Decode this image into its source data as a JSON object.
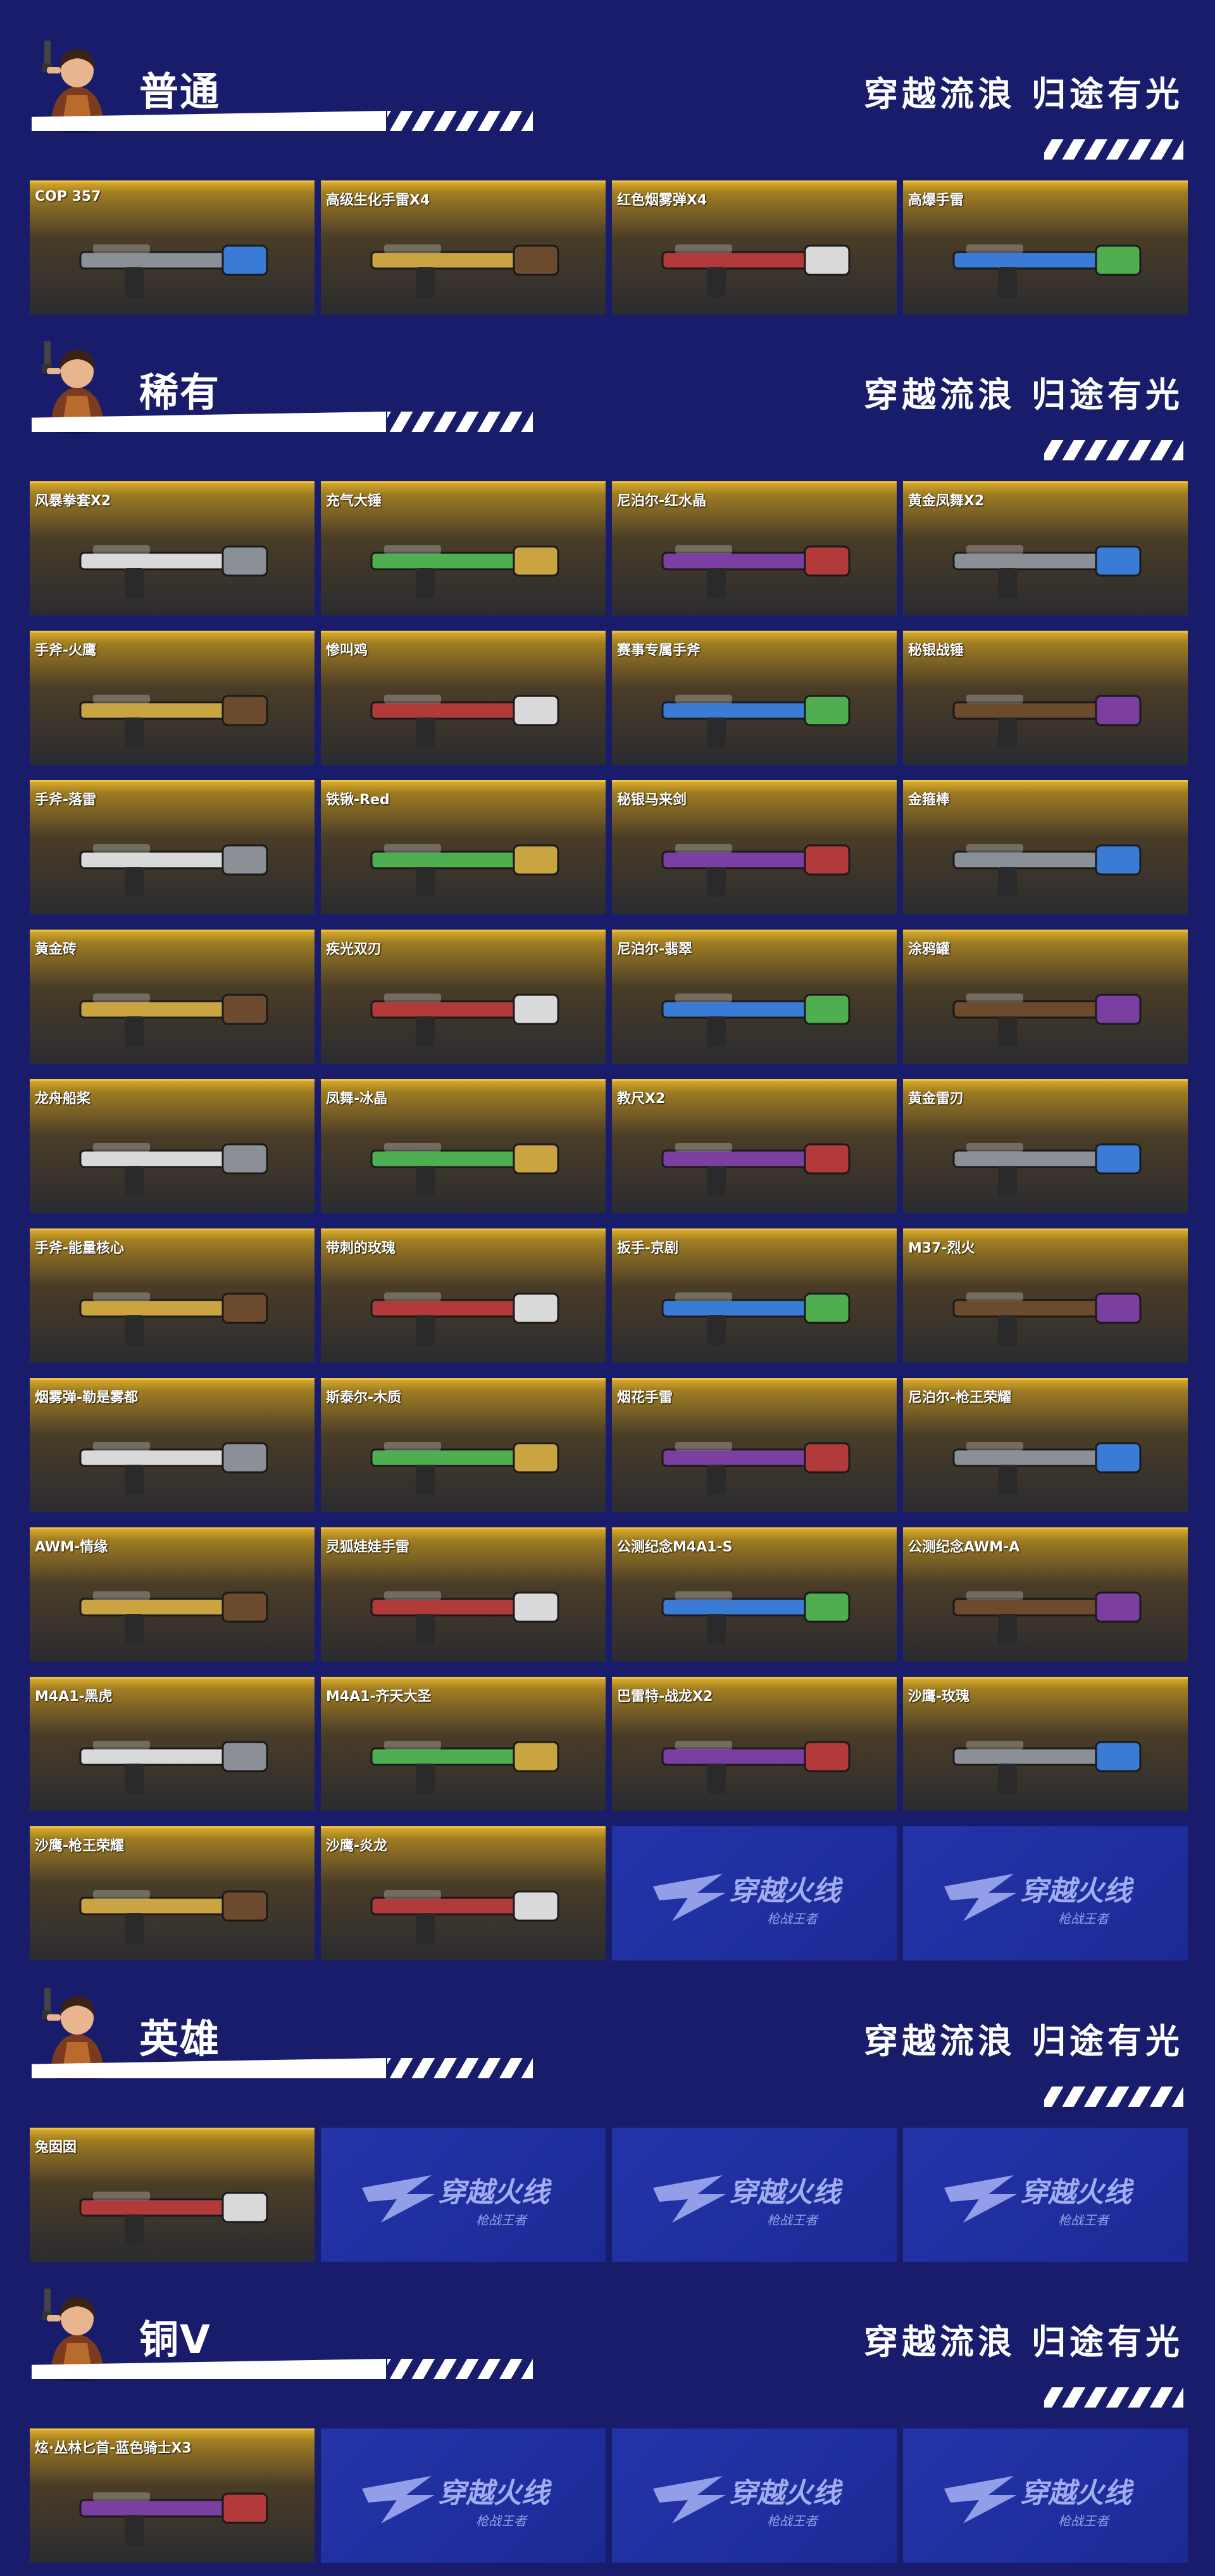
{
  "slogan": "穿越流浪 归途有光",
  "sections": [
    {
      "title": "普通",
      "items": [
        "COP 357",
        "高级生化手雷X4",
        "红色烟雾弹X4",
        "高爆手雷"
      ]
    },
    {
      "title": "稀有",
      "items": [
        "风暴拳套X2",
        "充气大锤",
        "尼泊尔-红水晶",
        "黄金凤舞X2",
        "手斧-火鹰",
        "惨叫鸡",
        "赛事专属手斧",
        "秘银战锤",
        "手斧-落雷",
        "铁锹-Red",
        "秘银马来剑",
        "金箍棒",
        "黄金砖",
        "疾光双刃",
        "尼泊尔-翡翠",
        "涂鸦罐",
        "龙舟船桨",
        "凤舞-冰晶",
        "教尺X2",
        "黄金雷刃",
        "手斧-能量核心",
        "带刺的玫瑰",
        "扳手-京剧",
        "M37-烈火",
        "烟雾弹-勒是雾都",
        "斯泰尔-木质",
        "烟花手雷",
        "尼泊尔-枪王荣耀",
        "AWM-情缘",
        "灵狐娃娃手雷",
        "公测纪念M4A1-S",
        "公测纪念AWM-A",
        "M4A1-黑虎",
        "M4A1-齐天大圣",
        "巴雷特-战龙X2",
        "沙鹰-玫瑰",
        "沙鹰-枪王荣耀",
        "沙鹰-炎龙"
      ]
    },
    {
      "title": "英雄",
      "items": [
        "兔囡囡"
      ]
    },
    {
      "title": "铜V",
      "items": [
        "炫·丛林匕首-蓝色骑士X3"
      ]
    }
  ],
  "promo_logo_text": "穿越火线",
  "promo_logo_sub": "枪战王者",
  "colors": {
    "background": "#181c6b",
    "card_gold": "#d6a92a",
    "promo_blue": "#2434a8"
  }
}
